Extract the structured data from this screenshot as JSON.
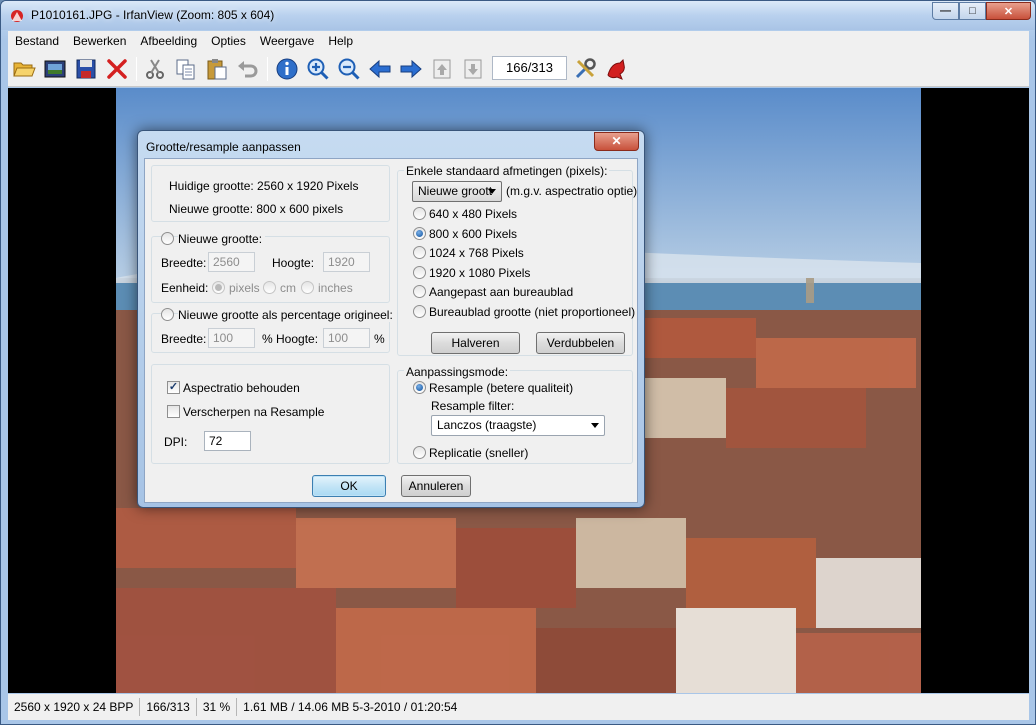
{
  "window": {
    "title": "P1010161.JPG - IrfanView (Zoom: 805 x 604)",
    "buttons": {
      "minimize": "—",
      "maximize": "□",
      "close": "✕"
    }
  },
  "menu": [
    "Bestand",
    "Bewerken",
    "Afbeelding",
    "Opties",
    "Weergave",
    "Help"
  ],
  "toolbar": {
    "counter": "166/313",
    "icons": [
      "open-folder-icon",
      "slideshow-icon",
      "save-icon",
      "delete-icon",
      "cut-icon",
      "copy-icon",
      "paste-icon",
      "undo-icon",
      "info-icon",
      "zoom-in-icon",
      "zoom-out-icon",
      "previous-arrow-icon",
      "next-arrow-icon",
      "first-page-icon",
      "last-page-icon",
      "settings-icon",
      "irfanview-cat-icon"
    ]
  },
  "dialog": {
    "title": "Grootte/resample aanpassen",
    "close": "✕",
    "current_size": "Huidige grootte:  2560  x  1920  Pixels",
    "new_size": "Nieuwe grootte:  800  x  600  pixels",
    "new_size_option": "Nieuwe grootte:",
    "width_label": "Breedte:",
    "width_value": "2560",
    "height_label": "Hoogte:",
    "height_value": "1920",
    "unit_label": "Eenheid:",
    "units": [
      "pixels",
      "cm",
      "inches"
    ],
    "percent_option": "Nieuwe grootte als percentage origineel:",
    "pct_width_label": "Breedte:",
    "pct_width_value": "100",
    "pct_symbol": "%",
    "pct_height_label": "Hoogte:",
    "pct_height_value": "100",
    "aspect_label": "Aspectratio behouden",
    "aspect_checked": true,
    "sharpen_label": "Verscherpen na Resample",
    "sharpen_checked": false,
    "dpi_label": "DPI:",
    "dpi_value": "72",
    "standard_title": "Enkele standaard afmetingen (pixels):",
    "standard_combo": "Nieuwe groott",
    "standard_note": "(m.g.v. aspectratio optie)",
    "standard_options": [
      "640 x 480 Pixels",
      "800 x 600 Pixels",
      "1024 x 768 Pixels",
      "1920 x 1080 Pixels",
      "Aangepast aan bureaublad",
      "Bureaublad grootte (niet proportioneel)"
    ],
    "standard_selected": 1,
    "halve_button": "Halveren",
    "double_button": "Verdubbelen",
    "mode_title": "Aanpassingsmode:",
    "resample_option": "Resample (betere qualiteit)",
    "filter_label": "Resample filter:",
    "filter_value": "Lanczos (traagste)",
    "replicate_option": "Replicatie (sneller)",
    "ok_button": "OK",
    "cancel_button": "Annuleren"
  },
  "status": [
    "2560 x 1920 x 24 BPP",
    "166/313",
    "31 %",
    "1.61 MB / 14.06 MB 5-3-2010 / 01:20:54"
  ]
}
